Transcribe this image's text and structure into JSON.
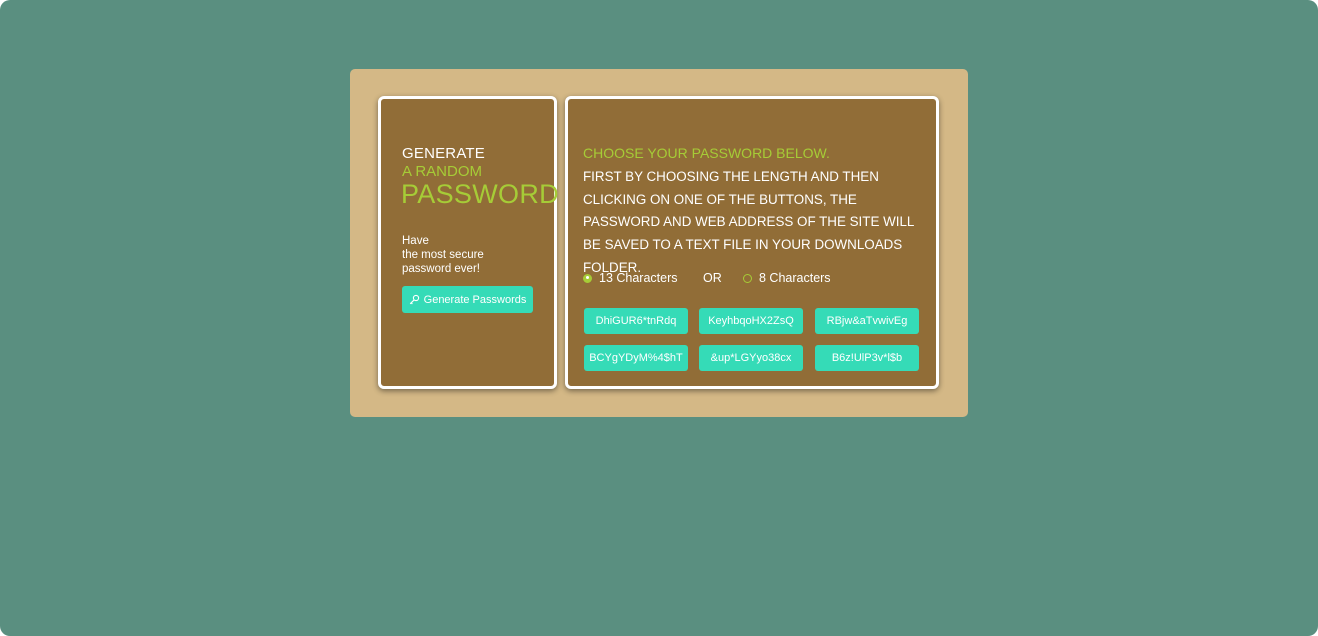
{
  "left_panel": {
    "title_line1": "GENERATE",
    "title_line2": "A RANDOM",
    "title_line3": "PASSWORD",
    "tagline_line1": "Have",
    "tagline_line2": "the most secure",
    "tagline_line3": "password ever!",
    "generate_button_label": "Generate Passwords",
    "generate_button_icon": "key-icon"
  },
  "right_panel": {
    "heading": "CHOOSE YOUR PASSWORD BELOW.",
    "description": "FIRST BY CHOOSING THE LENGTH AND THEN CLICKING ON ONE OF THE BUTTONS, THE PASSWORD AND WEB ADDRESS OF THE SITE WILL BE SAVED TO A TEXT FILE IN YOUR DOWNLOADS FOLDER.",
    "options": [
      {
        "label": "13 Characters",
        "checked": true
      },
      {
        "label": "8 Characters",
        "checked": false
      }
    ],
    "or_label": "OR",
    "passwords": [
      "DhiGUR6*tnRdq",
      "KeyhbqoHX2ZsQ",
      "RBjw&aTvwivEg",
      "BCYgYDyM%4$hT",
      "&up*LGYyo38cx",
      "B6z!UlP3v*l$b"
    ]
  },
  "colors": {
    "background": "#5a8f80",
    "frame": "#d4b886",
    "panel": "#916d37",
    "accent_green": "#a6cc37",
    "button": "#35dbb7"
  }
}
